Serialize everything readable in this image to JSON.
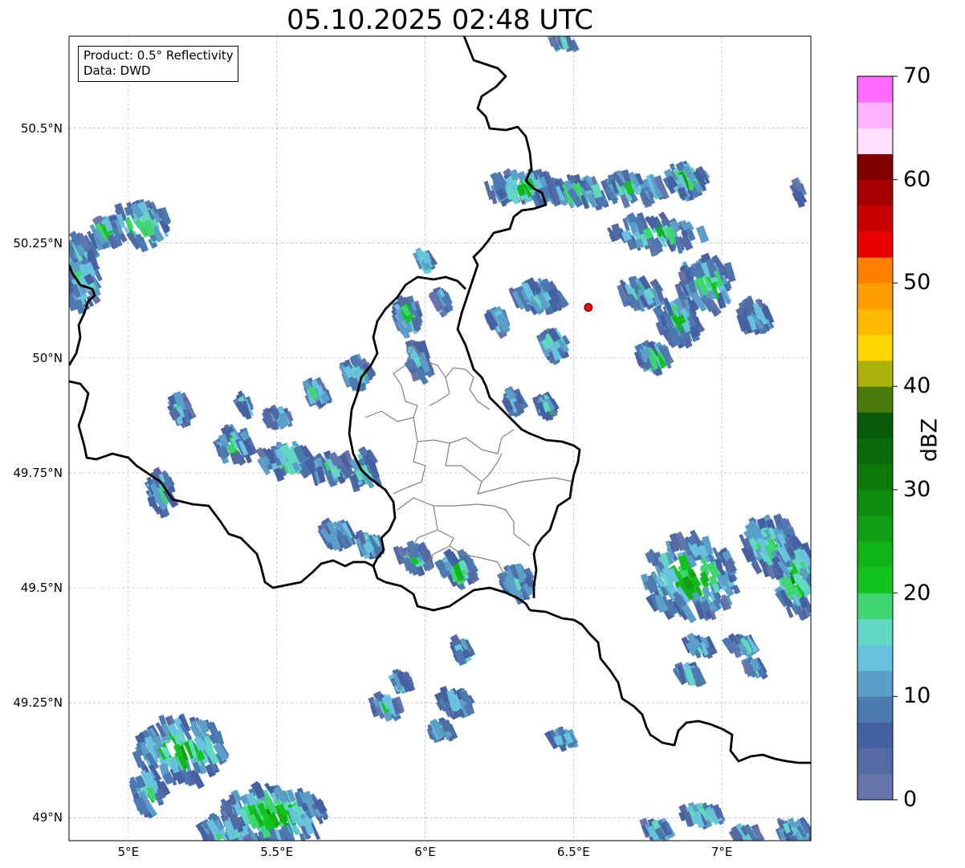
{
  "title": "05.10.2025 02:48 UTC",
  "info": {
    "product": "Product: 0.5° Reflectivity",
    "data": "Data: DWD"
  },
  "map": {
    "lon_range": [
      4.8,
      7.3
    ],
    "lat_range": [
      48.95,
      50.7
    ],
    "lat_ticks": [
      {
        "value": 50.5,
        "label": "50.5°N"
      },
      {
        "value": 50.25,
        "label": "50.25°N"
      },
      {
        "value": 50.0,
        "label": "50°N"
      },
      {
        "value": 49.75,
        "label": "49.75°N"
      },
      {
        "value": 49.5,
        "label": "49.5°N"
      },
      {
        "value": 49.25,
        "label": "49.25°N"
      },
      {
        "value": 49.0,
        "label": "49°N"
      }
    ],
    "lon_ticks": [
      {
        "value": 5.0,
        "label": "5°E"
      },
      {
        "value": 5.5,
        "label": "5.5°E"
      },
      {
        "value": 6.0,
        "label": "6°E"
      },
      {
        "value": 6.5,
        "label": "6.5°E"
      },
      {
        "value": 7.0,
        "label": "7°E"
      }
    ],
    "radar_site": {
      "lon": 6.55,
      "lat": 50.11,
      "color": "#ff0000"
    },
    "gridlines": true
  },
  "colorbar": {
    "label": "dBZ",
    "range": [
      0,
      70
    ],
    "ticks": [
      {
        "value": 0,
        "label": "0"
      },
      {
        "value": 10,
        "label": "10"
      },
      {
        "value": 20,
        "label": "20"
      },
      {
        "value": 30,
        "label": "30"
      },
      {
        "value": 40,
        "label": "40"
      },
      {
        "value": 50,
        "label": "50"
      },
      {
        "value": 60,
        "label": "60"
      },
      {
        "value": 70,
        "label": "70"
      }
    ],
    "colors": [
      "#6675aa",
      "#546aa4",
      "#4561a1",
      "#4c7ab0",
      "#5b9ec8",
      "#68c2de",
      "#62d8c4",
      "#3fd672",
      "#12c41e",
      "#12b517",
      "#129e12",
      "#0e8c0e",
      "#0b7a0b",
      "#0a6a0a",
      "#075a07",
      "#4a7a0a",
      "#aab10b",
      "#ffd700",
      "#ffba00",
      "#ff9d00",
      "#ff7f00",
      "#e80000",
      "#c90000",
      "#a50000",
      "#800000",
      "#ffe0ff",
      "#ffb2ff",
      "#ff6aff",
      "#ee34ee"
    ]
  }
}
